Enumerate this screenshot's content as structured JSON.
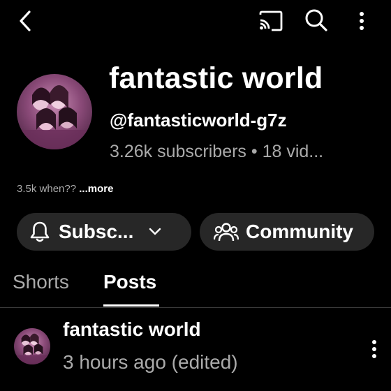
{
  "topbar": {
    "back_icon": "chevron-left-icon",
    "cast_icon": "cast-icon",
    "search_icon": "search-icon",
    "menu_icon": "more-vertical-icon"
  },
  "channel": {
    "name": "fantastic world",
    "handle": "@fantasticworld-g7z",
    "stats": "3.26k subscribers • 18 vid...",
    "description": "3.5k when??",
    "more_label": "...more"
  },
  "actions": {
    "subscribe_label": "Subsc...",
    "community_label": "Community"
  },
  "tabs": [
    {
      "label": "Shorts",
      "selected": false
    },
    {
      "label": "Posts",
      "selected": true
    }
  ],
  "post": {
    "author": "fantastic world",
    "time": "3 hours ago (edited)"
  },
  "colors": {
    "background": "#000000",
    "secondary_text": "#aaaaaa",
    "pill_background": "#272727",
    "avatar_tint": "#8a4a78"
  }
}
